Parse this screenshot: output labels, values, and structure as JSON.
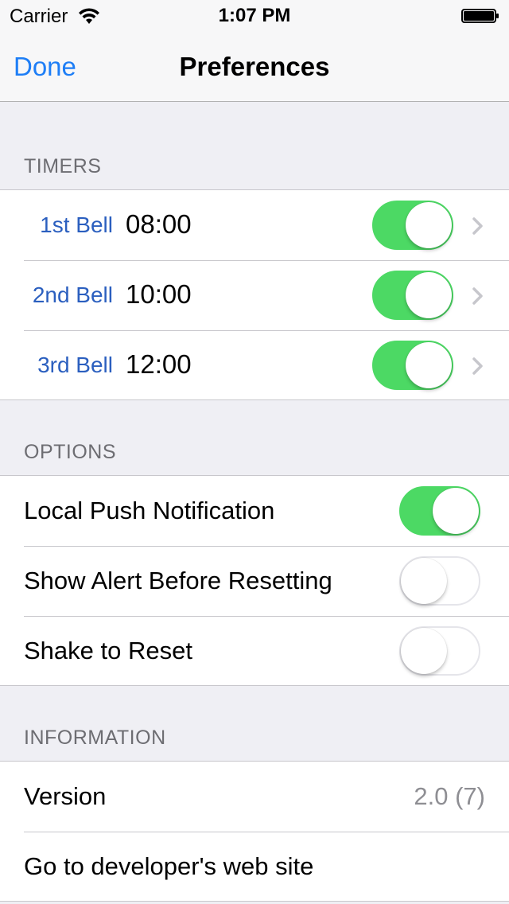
{
  "status_bar": {
    "carrier": "Carrier",
    "time": "1:07 PM",
    "wifi_icon": "wifi-icon",
    "battery_icon": "battery-icon"
  },
  "nav": {
    "done_label": "Done",
    "title": "Preferences"
  },
  "sections": {
    "timers": {
      "header": "TIMERS",
      "rows": [
        {
          "label": "1st Bell",
          "time": "08:00",
          "enabled": true
        },
        {
          "label": "2nd Bell",
          "time": "10:00",
          "enabled": true
        },
        {
          "label": "3rd Bell",
          "time": "12:00",
          "enabled": true
        }
      ]
    },
    "options": {
      "header": "OPTIONS",
      "rows": [
        {
          "label": "Local Push Notification",
          "enabled": true
        },
        {
          "label": "Show Alert Before Resetting",
          "enabled": false
        },
        {
          "label": "Shake to Reset",
          "enabled": false
        }
      ]
    },
    "information": {
      "header": "INFORMATION",
      "version_label": "Version",
      "version_value": "2.0 (7)",
      "website_label": "Go to developer's web site"
    }
  },
  "colors": {
    "accent": "#1e7ef6",
    "bell_label": "#2b5fbf",
    "toggle_on": "#4cd964",
    "background": "#efeff4"
  }
}
